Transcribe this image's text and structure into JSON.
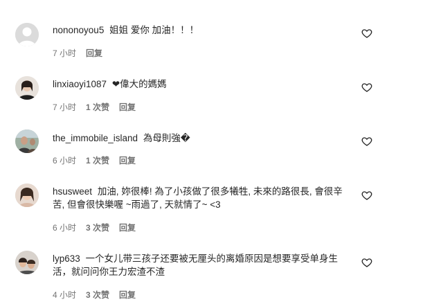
{
  "comments": [
    {
      "username": "nononoyou5",
      "text": "姐姐 爱你 加油！！！",
      "time": "7 小时",
      "likes": "",
      "reply": "回复",
      "avatar": "default-avatar"
    },
    {
      "username": "linxiaoyi1087",
      "text": "❤偉大的媽媽",
      "time": "7 小时",
      "likes": "1 次赞",
      "reply": "回复",
      "avatar": "user-photo-avatar"
    },
    {
      "username": "the_immobile_island",
      "text": "為母則強�",
      "time": "6 小时",
      "likes": "1 次赞",
      "reply": "回复",
      "avatar": "user-photo-avatar"
    },
    {
      "username": "hsusweet",
      "text": "加油, 妳很棒! 為了小孩做了很多犧牲, 未來的路很長, 會很辛苦, 但會很快樂喔 ~雨過了, 天就情了~ <3",
      "time": "6 小时",
      "likes": "3 次赞",
      "reply": "回复",
      "avatar": "user-photo-avatar"
    },
    {
      "username": "lyp633",
      "text": "一个女儿带三孩子还要被无厘头的离婚原因是想要享受单身生活，就问问你王力宏渣不渣",
      "time": "4 小时",
      "likes": "3 次赞",
      "reply": "回复",
      "avatar": "user-photo-avatar"
    }
  ],
  "colors": {
    "text": "#262626",
    "meta": "#737373",
    "default_avatar_bg": "#dbdbdb"
  }
}
